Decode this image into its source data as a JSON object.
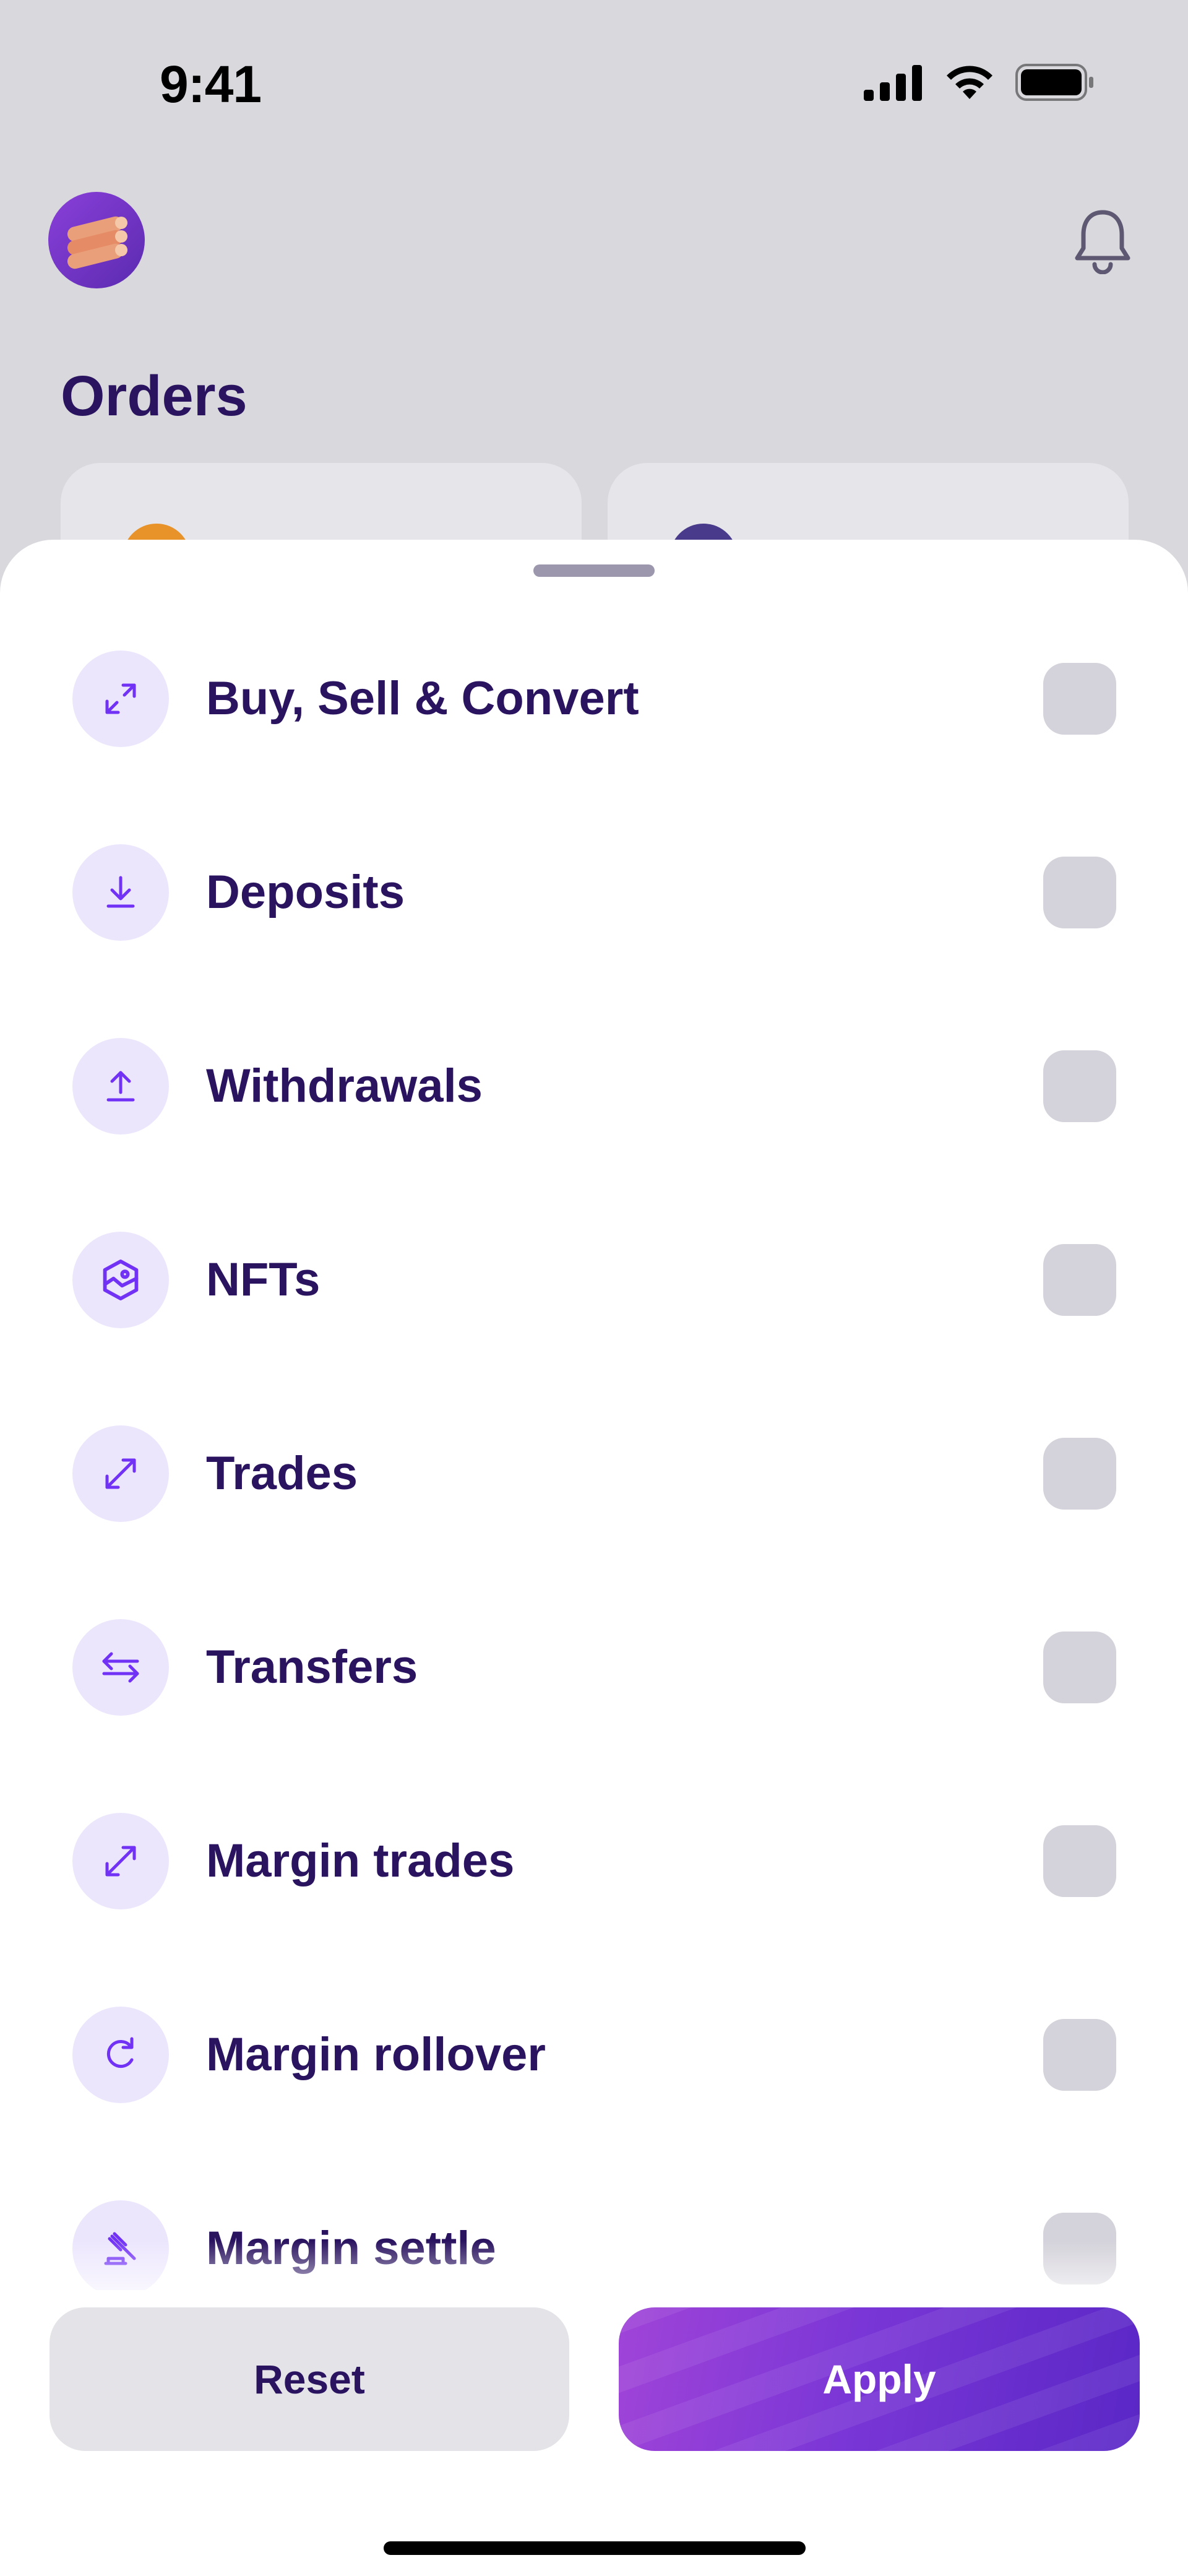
{
  "status_bar": {
    "time": "9:41"
  },
  "page": {
    "title": "Orders"
  },
  "sheet": {
    "filters": [
      {
        "label": "Buy, Sell & Convert",
        "icon": "buy-sell-convert-icon",
        "checked": false
      },
      {
        "label": "Deposits",
        "icon": "deposit-icon",
        "checked": false
      },
      {
        "label": "Withdrawals",
        "icon": "withdrawal-icon",
        "checked": false
      },
      {
        "label": "NFTs",
        "icon": "nft-icon",
        "checked": false
      },
      {
        "label": "Trades",
        "icon": "trades-icon",
        "checked": false
      },
      {
        "label": "Transfers",
        "icon": "transfers-icon",
        "checked": false
      },
      {
        "label": "Margin trades",
        "icon": "margin-trades-icon",
        "checked": false
      },
      {
        "label": "Margin rollover",
        "icon": "margin-rollover-icon",
        "checked": false
      },
      {
        "label": "Margin settle",
        "icon": "margin-settle-icon",
        "checked": false
      }
    ],
    "actions": {
      "reset_label": "Reset",
      "apply_label": "Apply"
    }
  },
  "colors": {
    "accent": "#7132f5",
    "text_primary": "#2a1460",
    "icon_bg": "#ece6fd",
    "checkbox_off": "#d4d2da"
  }
}
